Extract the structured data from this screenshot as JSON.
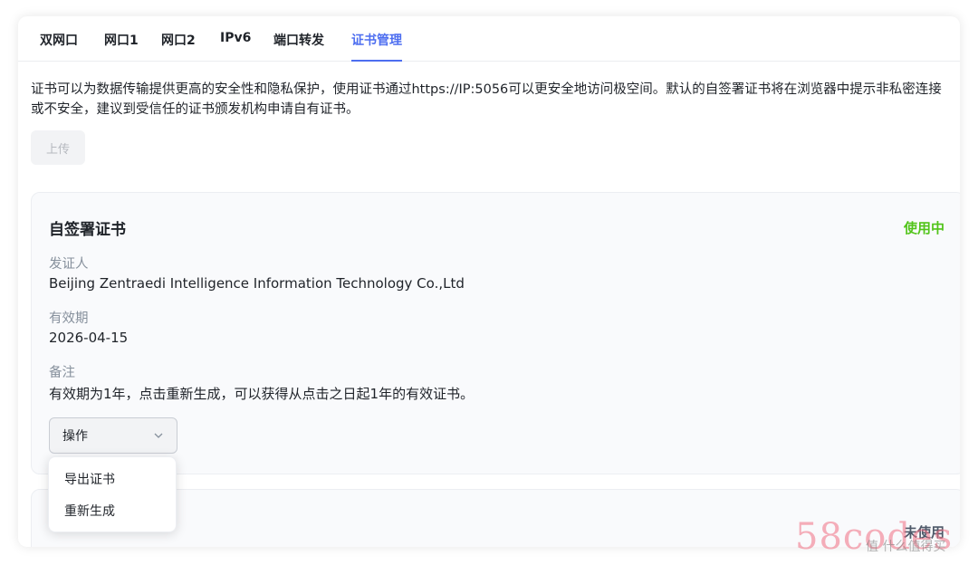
{
  "tabs": [
    {
      "label": "双网口"
    },
    {
      "label": "网口1"
    },
    {
      "label": "网口2"
    },
    {
      "label": "IPv6"
    },
    {
      "label": "端口转发"
    },
    {
      "label": "证书管理"
    }
  ],
  "description": "证书可以为数据传输提供更高的安全性和隐私保护，使用证书通过https://IP:5056可以更安全地访问极空间。默认的自签署证书将在浏览器中提示非私密连接或不安全，建议到受信任的证书颁发机构申请自有证书。",
  "upload_label": "上传",
  "card": {
    "title": "自签署证书",
    "status": "使用中",
    "status_color": "#52c41a",
    "fields": [
      {
        "label": "发证人",
        "value": "Beijing Zentraedi Intelligence Information Technology Co.,Ltd"
      },
      {
        "label": "有效期",
        "value": "2026-04-15"
      },
      {
        "label": "备注",
        "value": "有效期为1年，点击重新生成，可以获得从点击之日起1年的有效证书。"
      }
    ],
    "action_select": {
      "label": "操作",
      "icon": "chevron-down-icon"
    },
    "menu": [
      {
        "label": "导出证书"
      },
      {
        "label": "重新生成"
      }
    ]
  },
  "card2": {
    "status": "未使用"
  },
  "watermark": {
    "text": "58codes",
    "sub": "值 什么值得买"
  },
  "accent_color": "#4d6ef0"
}
